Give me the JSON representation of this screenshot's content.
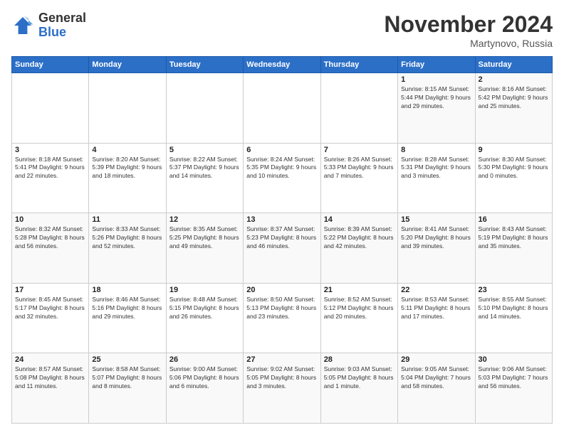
{
  "logo": {
    "general": "General",
    "blue": "Blue"
  },
  "title": "November 2024",
  "location": "Martynovo, Russia",
  "days_header": [
    "Sunday",
    "Monday",
    "Tuesday",
    "Wednesday",
    "Thursday",
    "Friday",
    "Saturday"
  ],
  "weeks": [
    [
      {
        "day": "",
        "info": ""
      },
      {
        "day": "",
        "info": ""
      },
      {
        "day": "",
        "info": ""
      },
      {
        "day": "",
        "info": ""
      },
      {
        "day": "",
        "info": ""
      },
      {
        "day": "1",
        "info": "Sunrise: 8:15 AM\nSunset: 5:44 PM\nDaylight: 9 hours and 29 minutes."
      },
      {
        "day": "2",
        "info": "Sunrise: 8:16 AM\nSunset: 5:42 PM\nDaylight: 9 hours and 25 minutes."
      }
    ],
    [
      {
        "day": "3",
        "info": "Sunrise: 8:18 AM\nSunset: 5:41 PM\nDaylight: 9 hours and 22 minutes."
      },
      {
        "day": "4",
        "info": "Sunrise: 8:20 AM\nSunset: 5:39 PM\nDaylight: 9 hours and 18 minutes."
      },
      {
        "day": "5",
        "info": "Sunrise: 8:22 AM\nSunset: 5:37 PM\nDaylight: 9 hours and 14 minutes."
      },
      {
        "day": "6",
        "info": "Sunrise: 8:24 AM\nSunset: 5:35 PM\nDaylight: 9 hours and 10 minutes."
      },
      {
        "day": "7",
        "info": "Sunrise: 8:26 AM\nSunset: 5:33 PM\nDaylight: 9 hours and 7 minutes."
      },
      {
        "day": "8",
        "info": "Sunrise: 8:28 AM\nSunset: 5:31 PM\nDaylight: 9 hours and 3 minutes."
      },
      {
        "day": "9",
        "info": "Sunrise: 8:30 AM\nSunset: 5:30 PM\nDaylight: 9 hours and 0 minutes."
      }
    ],
    [
      {
        "day": "10",
        "info": "Sunrise: 8:32 AM\nSunset: 5:28 PM\nDaylight: 8 hours and 56 minutes."
      },
      {
        "day": "11",
        "info": "Sunrise: 8:33 AM\nSunset: 5:26 PM\nDaylight: 8 hours and 52 minutes."
      },
      {
        "day": "12",
        "info": "Sunrise: 8:35 AM\nSunset: 5:25 PM\nDaylight: 8 hours and 49 minutes."
      },
      {
        "day": "13",
        "info": "Sunrise: 8:37 AM\nSunset: 5:23 PM\nDaylight: 8 hours and 46 minutes."
      },
      {
        "day": "14",
        "info": "Sunrise: 8:39 AM\nSunset: 5:22 PM\nDaylight: 8 hours and 42 minutes."
      },
      {
        "day": "15",
        "info": "Sunrise: 8:41 AM\nSunset: 5:20 PM\nDaylight: 8 hours and 39 minutes."
      },
      {
        "day": "16",
        "info": "Sunrise: 8:43 AM\nSunset: 5:19 PM\nDaylight: 8 hours and 35 minutes."
      }
    ],
    [
      {
        "day": "17",
        "info": "Sunrise: 8:45 AM\nSunset: 5:17 PM\nDaylight: 8 hours and 32 minutes."
      },
      {
        "day": "18",
        "info": "Sunrise: 8:46 AM\nSunset: 5:16 PM\nDaylight: 8 hours and 29 minutes."
      },
      {
        "day": "19",
        "info": "Sunrise: 8:48 AM\nSunset: 5:15 PM\nDaylight: 8 hours and 26 minutes."
      },
      {
        "day": "20",
        "info": "Sunrise: 8:50 AM\nSunset: 5:13 PM\nDaylight: 8 hours and 23 minutes."
      },
      {
        "day": "21",
        "info": "Sunrise: 8:52 AM\nSunset: 5:12 PM\nDaylight: 8 hours and 20 minutes."
      },
      {
        "day": "22",
        "info": "Sunrise: 8:53 AM\nSunset: 5:11 PM\nDaylight: 8 hours and 17 minutes."
      },
      {
        "day": "23",
        "info": "Sunrise: 8:55 AM\nSunset: 5:10 PM\nDaylight: 8 hours and 14 minutes."
      }
    ],
    [
      {
        "day": "24",
        "info": "Sunrise: 8:57 AM\nSunset: 5:08 PM\nDaylight: 8 hours and 11 minutes."
      },
      {
        "day": "25",
        "info": "Sunrise: 8:58 AM\nSunset: 5:07 PM\nDaylight: 8 hours and 8 minutes."
      },
      {
        "day": "26",
        "info": "Sunrise: 9:00 AM\nSunset: 5:06 PM\nDaylight: 8 hours and 6 minutes."
      },
      {
        "day": "27",
        "info": "Sunrise: 9:02 AM\nSunset: 5:05 PM\nDaylight: 8 hours and 3 minutes."
      },
      {
        "day": "28",
        "info": "Sunrise: 9:03 AM\nSunset: 5:05 PM\nDaylight: 8 hours and 1 minute."
      },
      {
        "day": "29",
        "info": "Sunrise: 9:05 AM\nSunset: 5:04 PM\nDaylight: 7 hours and 58 minutes."
      },
      {
        "day": "30",
        "info": "Sunrise: 9:06 AM\nSunset: 5:03 PM\nDaylight: 7 hours and 56 minutes."
      }
    ]
  ]
}
